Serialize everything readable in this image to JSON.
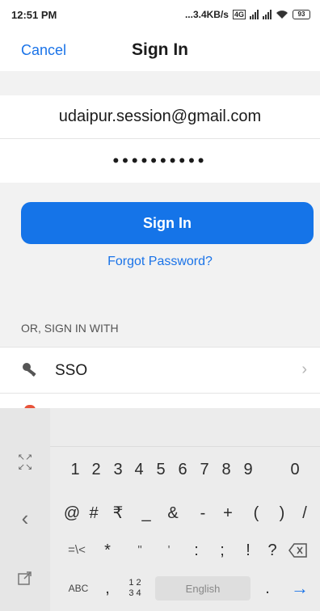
{
  "status_bar": {
    "time": "12:51 PM",
    "network_speed": "...3.4KB/s",
    "battery": "93"
  },
  "nav": {
    "cancel_label": "Cancel",
    "title": "Sign In"
  },
  "form": {
    "email_value": "udaipur.session@gmail.com",
    "password_masked": "••••••••••"
  },
  "actions": {
    "signin_label": "Sign In",
    "forgot_label": "Forgot Password?"
  },
  "alt_signin": {
    "header": "OR, SIGN IN WITH",
    "items": [
      {
        "label": "SSO",
        "icon": "key-icon"
      }
    ]
  },
  "keyboard": {
    "row1": [
      "1",
      "2",
      "3",
      "4",
      "5",
      "6",
      "7",
      "8",
      "9",
      "0"
    ],
    "row2": [
      "@",
      "#",
      "₹",
      "_",
      "&",
      "-",
      "+",
      "(",
      ")",
      "/"
    ],
    "row3": [
      "=\\<",
      "*",
      "\"",
      "'",
      ":",
      ";",
      "!",
      "?"
    ],
    "bottom": {
      "abc_label": "ABC",
      "comma": ",",
      "fraction_top": "1 2",
      "fraction_bottom": "3 4",
      "space_label": "English",
      "period": "."
    }
  }
}
